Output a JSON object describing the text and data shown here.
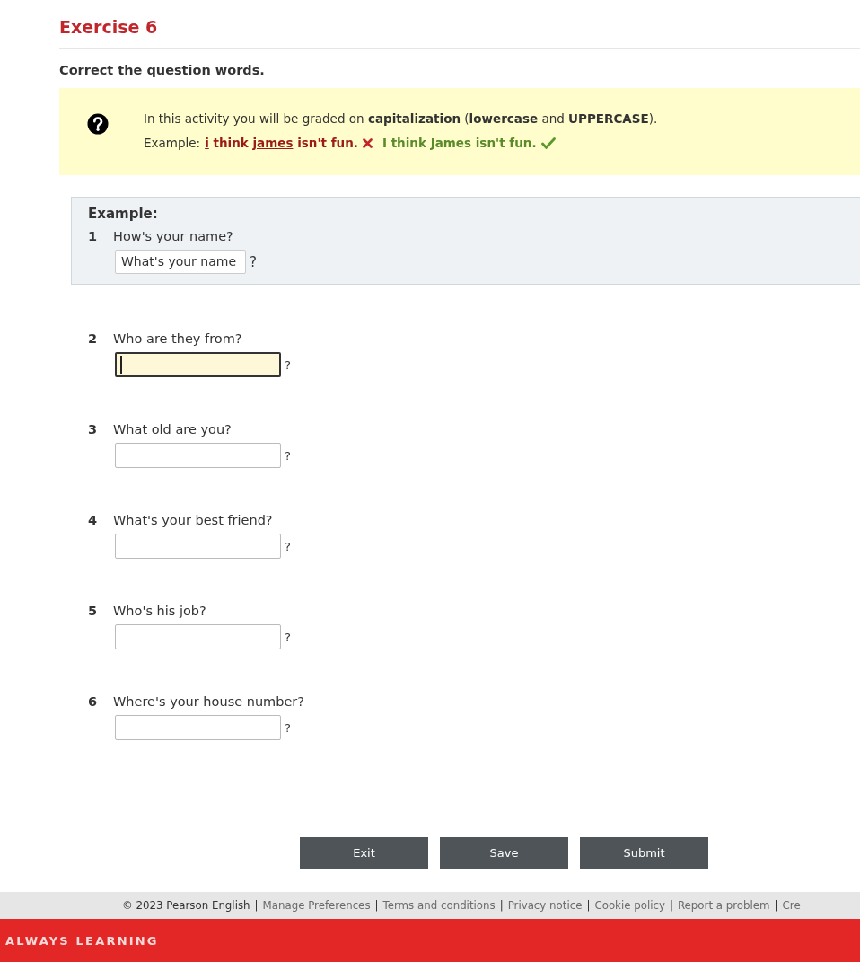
{
  "title": "Exercise 6",
  "instruction": "Correct the question words.",
  "notice": {
    "text": "In this activity you will be graded on **capitalization** (**lowercase** and **UPPERCASE**).",
    "example_label": "Example:",
    "wrong": [
      {
        "text": "i",
        "underlined": true
      },
      {
        "text": " think ",
        "underlined": false
      },
      {
        "text": "james",
        "underlined": true
      },
      {
        "text": " isn't fun.",
        "underlined": false
      }
    ],
    "right": "I think James isn't fun."
  },
  "example": {
    "label": "Example:",
    "number": "1",
    "question": "How's your name?",
    "answer": "What's your name",
    "suffix": "?"
  },
  "questions": [
    {
      "number": "2",
      "question": "Who are they from?",
      "focused": true,
      "suffix": "?"
    },
    {
      "number": "3",
      "question": "What old are you?",
      "focused": false,
      "suffix": "?"
    },
    {
      "number": "4",
      "question": "What's your best friend?",
      "focused": false,
      "suffix": "?"
    },
    {
      "number": "5",
      "question": "Who's his job?",
      "focused": false,
      "suffix": "?"
    },
    {
      "number": "6",
      "question": "Where's your house number?",
      "focused": false,
      "suffix": "?"
    }
  ],
  "buttons": [
    "Exit",
    "Save",
    "Submit"
  ],
  "footer": {
    "separator": "|",
    "items": [
      {
        "text": "© 2023 Pearson English",
        "kind": "copyright"
      },
      {
        "text": "Manage Preferences",
        "kind": "link"
      },
      {
        "text": "Terms and conditions",
        "kind": "link"
      },
      {
        "text": "Privacy notice",
        "kind": "link"
      },
      {
        "text": "Cookie policy",
        "kind": "link"
      },
      {
        "text": "Report a problem",
        "kind": "link"
      },
      {
        "text": "Cre",
        "kind": "link"
      }
    ]
  },
  "brand_bar": "ALWAYS LEARNING"
}
